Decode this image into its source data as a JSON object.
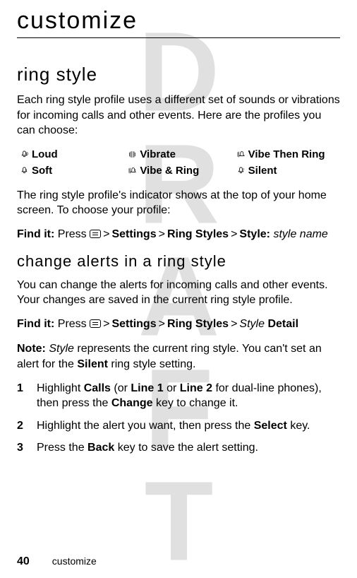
{
  "watermark": "DRAFT",
  "title": "customize",
  "section1": {
    "heading": "ring style",
    "intro": "Each ring style profile uses a different set of sounds or vibrations for incoming calls and other events. Here are the profiles you can choose:",
    "profiles": [
      {
        "icon": "🔔»",
        "label": "Loud"
      },
      {
        "icon": "》《",
        "label": "Vibrate"
      },
      {
        "icon": "》🔔",
        "label": "Vibe Then Ring"
      },
      {
        "icon": "🔔›",
        "label": "Soft"
      },
      {
        "icon": "《🔔",
        "label": "Vibe & Ring"
      },
      {
        "icon": "🔔z",
        "label": "Silent"
      }
    ],
    "after": "The ring style profile's indicator shows at the top of your home screen. To choose your profile:",
    "findit": {
      "prefix": "Find it:",
      "press": "Press",
      "path": [
        "Settings",
        "Ring Styles"
      ],
      "style_label": "Style:",
      "style_value": "style name"
    }
  },
  "section2": {
    "heading": "change alerts in a ring style",
    "intro": "You can change the alerts for incoming calls and other events. Your changes are saved in the current ring style profile.",
    "findit": {
      "prefix": "Find it:",
      "press": "Press",
      "path": [
        "Settings",
        "Ring Styles"
      ],
      "style_italic": "Style",
      "detail": "Detail"
    },
    "note_prefix": "Note:",
    "note_before": " ",
    "note_italic": "Style",
    "note_mid": " represents the current ring style. You can't set an alert for the ",
    "note_bold": "Silent",
    "note_after": " ring style setting.",
    "steps": [
      {
        "num": "1",
        "segments": [
          {
            "t": "Highlight "
          },
          {
            "t": "Calls",
            "bold": true
          },
          {
            "t": " (or "
          },
          {
            "t": "Line 1",
            "bold": true
          },
          {
            "t": " or "
          },
          {
            "t": "Line 2",
            "bold": true
          },
          {
            "t": " for dual-line phones), then press the "
          },
          {
            "t": "Change",
            "bold": true
          },
          {
            "t": " key to change it."
          }
        ]
      },
      {
        "num": "2",
        "segments": [
          {
            "t": "Highlight the alert you want, then press the "
          },
          {
            "t": "Select",
            "bold": true
          },
          {
            "t": " key."
          }
        ]
      },
      {
        "num": "3",
        "segments": [
          {
            "t": "Press the "
          },
          {
            "t": "Back",
            "bold": true
          },
          {
            "t": " key to save the alert setting."
          }
        ]
      }
    ]
  },
  "footer": {
    "page": "40",
    "section": "customize"
  }
}
